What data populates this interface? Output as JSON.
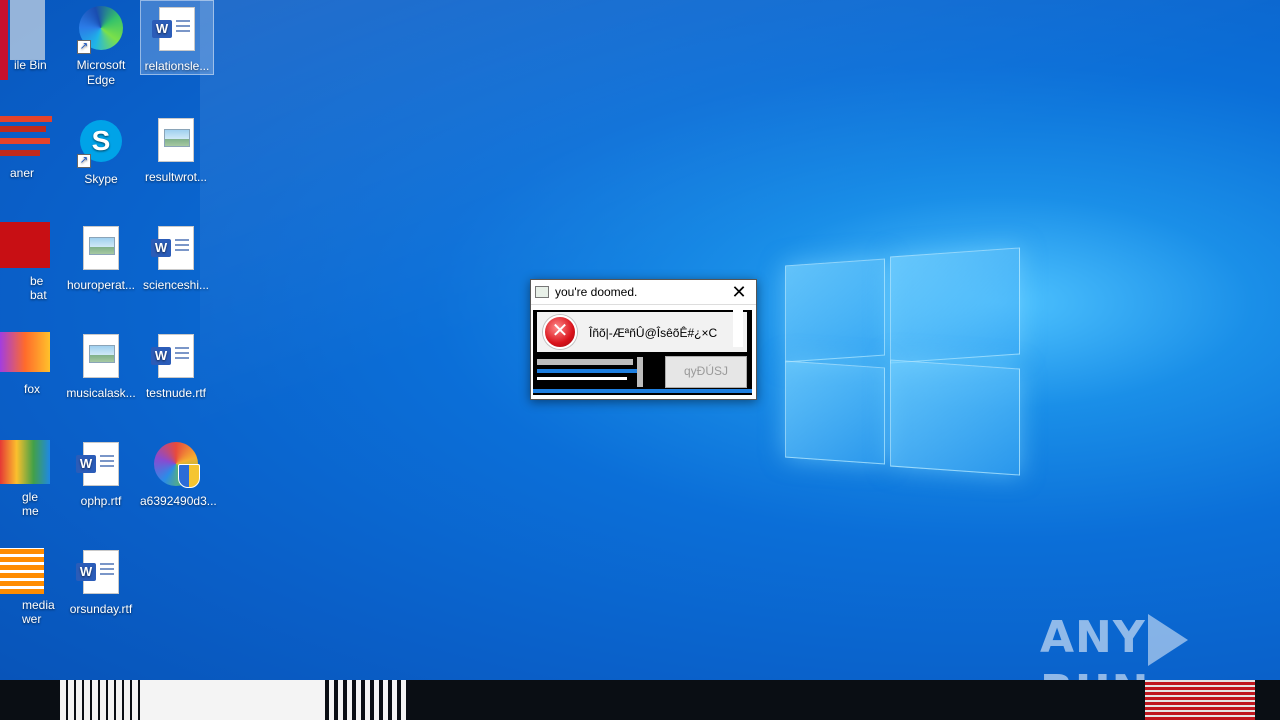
{
  "desktop": {
    "icons_col2": [
      {
        "label": "Microsoft Edge",
        "icon": "edge-icon"
      },
      {
        "label": "Skype",
        "icon": "skype-icon"
      },
      {
        "label": "houroperat...",
        "icon": "image-file-icon"
      },
      {
        "label": "musicalask...",
        "icon": "image-file-icon"
      },
      {
        "label": "ophp.rtf",
        "icon": "word-doc-icon"
      },
      {
        "label": "orsunday.rtf",
        "icon": "word-doc-icon"
      }
    ],
    "icons_col3": [
      {
        "label": "relationsle...",
        "icon": "word-doc-icon"
      },
      {
        "label": "resultwrot...",
        "icon": "image-file-icon"
      },
      {
        "label": "scienceshi...",
        "icon": "word-doc-icon"
      },
      {
        "label": "testnude.rtf",
        "icon": "word-doc-icon"
      },
      {
        "label": "a6392490d3...",
        "icon": "installer-icon"
      }
    ],
    "glitched_col1": [
      {
        "label": "ile Bin"
      },
      {
        "label": "aner"
      },
      {
        "label": "be\nbat"
      },
      {
        "label": "fox"
      },
      {
        "label": "gle\nme"
      },
      {
        "label": "media\nwer"
      }
    ]
  },
  "dialog": {
    "title": "you're doomed.",
    "message": "Îñõ|-ÆªñÛ@ÎsêõÊ#¿×C",
    "button_label": "qyÐÚSJ"
  },
  "watermark": {
    "left": "ANY",
    "right": "RUN"
  },
  "colors": {
    "desktop_blue": "#0b6fd8",
    "error_red": "#d9121b",
    "word_blue": "#2b5cb8"
  }
}
